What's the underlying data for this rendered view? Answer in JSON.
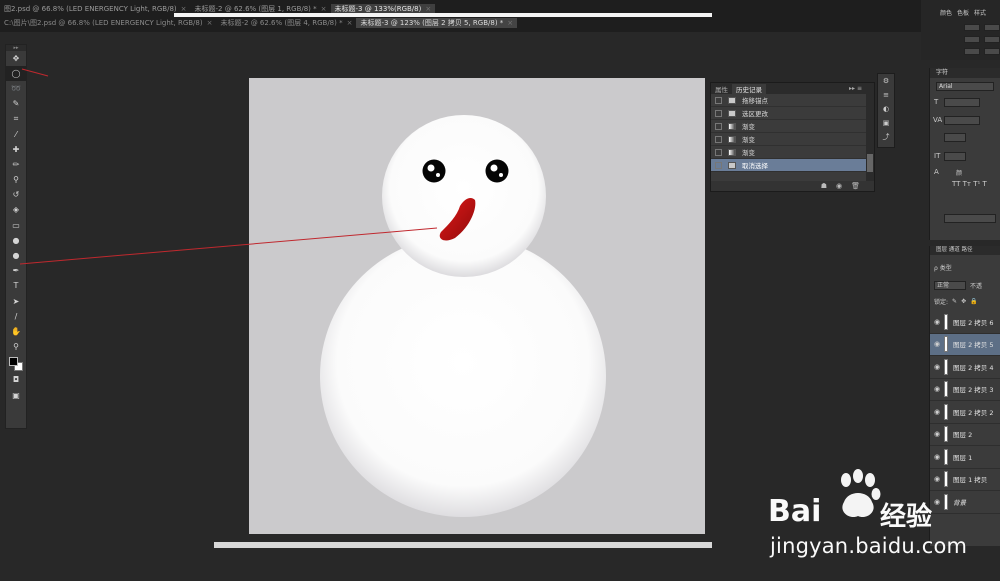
{
  "tabs_row1": [
    {
      "label": "图2.psd @ 66.8% (LED ENERGENCY Light, RGB/8)",
      "active": false
    },
    {
      "label": "未标题-2 @ 62.6% (图层 1, RGB/8) *",
      "active": false
    },
    {
      "label": "未标题-3 @ 133%(RGB/8)",
      "active": true
    }
  ],
  "tabs_row2": [
    {
      "label": "C:\\图片\\图2.psd @ 66.8% (LED ENERGENCY Light, RGB/8)",
      "active": false
    },
    {
      "label": "未标题-2 @ 62.6% (图层 4, RGB/8) *",
      "active": false
    },
    {
      "label": "未标题-3 @ 123% (图层 2 拷贝 5, RGB/8) *",
      "active": true
    }
  ],
  "tab_close_glyph": "×",
  "toolbar": {
    "header": "▸▸",
    "tools": [
      {
        "name": "move-tool-icon",
        "glyph": "✥"
      },
      {
        "name": "elliptical-marquee-tool-icon",
        "glyph": "◯",
        "selected": true
      },
      {
        "name": "lasso-tool-icon",
        "glyph": "➿"
      },
      {
        "name": "quick-selection-tool-icon",
        "glyph": "✎"
      },
      {
        "name": "crop-tool-icon",
        "glyph": "⌗"
      },
      {
        "name": "eyedropper-tool-icon",
        "glyph": "⁄"
      },
      {
        "name": "healing-brush-tool-icon",
        "glyph": "✚"
      },
      {
        "name": "brush-tool-icon",
        "glyph": "✏"
      },
      {
        "name": "clone-stamp-tool-icon",
        "glyph": "⚲"
      },
      {
        "name": "history-brush-tool-icon",
        "glyph": "↺"
      },
      {
        "name": "eraser-tool-icon",
        "glyph": "◈"
      },
      {
        "name": "gradient-tool-icon",
        "glyph": "▭"
      },
      {
        "name": "blur-tool-icon",
        "glyph": "●"
      },
      {
        "name": "dodge-tool-icon",
        "glyph": "●"
      },
      {
        "name": "pen-tool-icon",
        "glyph": "✒"
      },
      {
        "name": "type-tool-icon",
        "glyph": "T"
      },
      {
        "name": "path-selection-tool-icon",
        "glyph": "➤"
      },
      {
        "name": "line-tool-icon",
        "glyph": "/"
      },
      {
        "name": "hand-tool-icon",
        "glyph": "✋"
      },
      {
        "name": "zoom-tool-icon",
        "glyph": "⚲"
      }
    ],
    "quick_mask_glyph": "◘",
    "screen_mode_glyph": "▣"
  },
  "history_panel": {
    "tabs": [
      "属性",
      "历史记录"
    ],
    "menu_glyph": "▸▸ ≡",
    "rows": [
      {
        "label": "拖移锚点",
        "type": "doc",
        "selected": false
      },
      {
        "label": "选区更改",
        "type": "doc",
        "selected": false
      },
      {
        "label": "渐变",
        "type": "gradient",
        "selected": false
      },
      {
        "label": "渐变",
        "type": "gradient",
        "selected": false
      },
      {
        "label": "渐变",
        "type": "gradient",
        "selected": false
      },
      {
        "label": "取消选择",
        "type": "doc",
        "selected": true
      }
    ],
    "footer_icons": [
      "☗",
      "◉",
      "🗑"
    ]
  },
  "mini_strip_glyphs": [
    "⚙",
    "≡",
    "◐",
    "▣",
    "⤴"
  ],
  "right_top": {
    "tabs": [
      "颜色",
      "色板",
      "样式"
    ]
  },
  "character_panel": {
    "title": "字符",
    "font": "Arial",
    "labels": [
      "T",
      "VA",
      "IT",
      "A",
      "颜"
    ],
    "style_buttons": "TT Tт T¹ T"
  },
  "layers_panel": {
    "tabs": "图层   通道   路径",
    "kind": "ρ 类型",
    "blend_mode": "正常",
    "opacity_label": "不透",
    "lock_label": "锁定:",
    "layers": [
      {
        "name": "图层 2 拷贝 6",
        "selected": false,
        "italic": false
      },
      {
        "name": "图层 2 拷贝 5",
        "selected": true,
        "italic": false
      },
      {
        "name": "图层 2 拷贝 4",
        "selected": false,
        "italic": false
      },
      {
        "name": "图层 2 拷贝 3",
        "selected": false,
        "italic": false
      },
      {
        "name": "图层 2 拷贝 2",
        "selected": false,
        "italic": false
      },
      {
        "name": "图层 2",
        "selected": false,
        "italic": false
      },
      {
        "name": "图层 1",
        "selected": false,
        "italic": false
      },
      {
        "name": "图层 1 拷贝",
        "selected": false,
        "italic": false
      },
      {
        "name": "背景",
        "selected": false,
        "italic": true
      }
    ],
    "eye_glyph": "👁"
  },
  "watermark": {
    "brand": "Bai",
    "brand_cn": "经验",
    "url": "jingyan.baidu.com"
  },
  "colors": {
    "canvas_bg": "#cbcacc",
    "history_selected": "#6a7d98",
    "layer_selected": "#5d6f86",
    "annotation": "#c0282e"
  }
}
